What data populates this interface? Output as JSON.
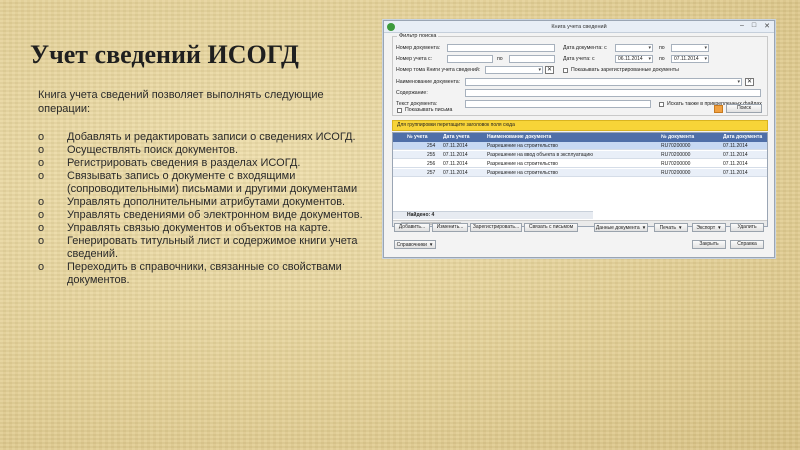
{
  "slide": {
    "title": "Учет сведений ИСОГД",
    "intro": "Книга учета сведений позволяет выполнять следующие операции:",
    "bullet_marker": "o",
    "bullets": [
      "Добавлять и редактировать записи о сведениях ИСОГД.",
      "Осуществлять поиск документов.",
      "Регистрировать сведения в разделах ИСОГД.",
      "Связывать запись о документе с входящими (сопроводительными) письмами и другими документами",
      "Управлять дополнительными атрибутами документов.",
      "Управлять сведениями об электронном виде документов.",
      "Управлять связью документов и объектов на карте.",
      "Генерировать титульный лист и содержимое книги учета сведений.",
      "Переходить в справочники, связанные со свойствами документов."
    ]
  },
  "window": {
    "title": "Книга учета сведений",
    "controls": {
      "minimize": "–",
      "maximize": "□",
      "close": "✕"
    },
    "filter": {
      "legend": "Фильтр поиска",
      "doc_number_label": "Номер документа:",
      "doc_date_from_label": "Дата документа: с",
      "to_label": "по",
      "reg_number_from_label": "Номер учета с:",
      "reg_date_from_label": "Дата учета: с",
      "reg_date_from_value": "06.11.2014",
      "reg_date_to_value": "07.11.2014",
      "book_number_label": "Номер тома Книги учета сведений:",
      "show_registered_label": "Показывать зарегистрированные документы",
      "doc_name_label": "Наименование документа:",
      "content_label": "Содержание:",
      "doc_text_label": "Текст документа:",
      "search_attached_label": "Искать также в прикрепленных файлах",
      "show_letters_label": "Показывать письма",
      "search_button": "Поиск"
    },
    "group_hint": "Для группировки перетащите заголовок поля сюда",
    "grid": {
      "columns": [
        "№ учета",
        "Дата учета",
        "Наименование документа",
        "№ документа",
        "Дата документа"
      ],
      "rows": [
        {
          "num": "254",
          "date": "07.11.2014",
          "name": "Разрешение на строительство",
          "doc_num": "RU70200000",
          "doc_date": "07.11.2014"
        },
        {
          "num": "255",
          "date": "07.11.2014",
          "name": "Разрешение на ввод объекта в эксплуатацию",
          "doc_num": "RU70200000",
          "doc_date": "07.11.2014"
        },
        {
          "num": "256",
          "date": "07.11.2014",
          "name": "Разрешение на строительство",
          "doc_num": "RU70200000",
          "doc_date": "07.11.2014"
        },
        {
          "num": "257",
          "date": "07.11.2014",
          "name": "Разрешение на строительство",
          "doc_num": "RU70200000",
          "doc_date": "07.11.2014"
        }
      ],
      "found_label": "Найдено: 4"
    },
    "toolbar": {
      "add": "Добавить...",
      "edit": "Изменить...",
      "register": "Зарегистрировать...",
      "link_letter": "Связать с письмом",
      "doc_data": "Данные документа",
      "print": "Печать",
      "export": "Экспорт",
      "delete": "Удалить"
    },
    "footer": {
      "references": "Справочники",
      "close": "Закрыть",
      "help": "Справка"
    }
  }
}
